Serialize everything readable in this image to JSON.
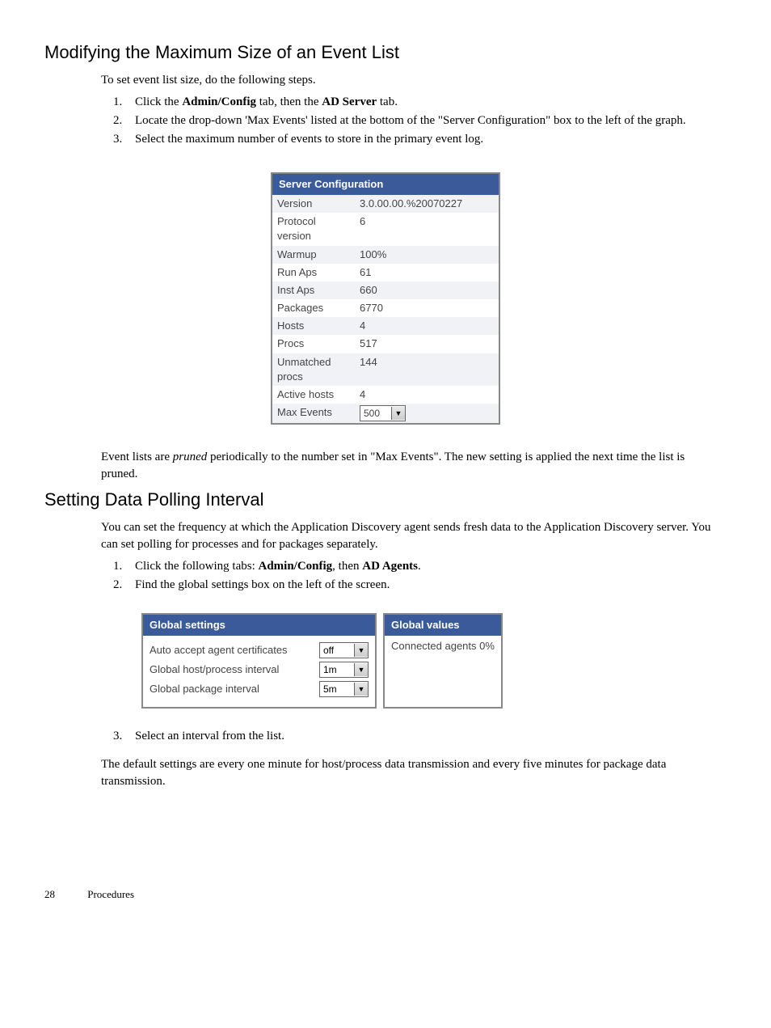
{
  "section1": {
    "heading": "Modifying the Maximum Size of an Event List",
    "intro": "To set event list size, do the following steps.",
    "steps": [
      {
        "pre": "Click the ",
        "b1": "Admin/Config",
        "mid": " tab, then the ",
        "b2": "AD Server",
        "post": " tab."
      },
      {
        "text": "Locate the drop-down 'Max Events' listed at the bottom of the \"Server Configuration\" box to the left of the graph."
      },
      {
        "text": "Select the maximum number of events to store in the primary event log."
      }
    ],
    "para2_a": "Event lists are ",
    "para2_i": "pruned",
    "para2_b": " periodically to the number set in \"Max Events\". The new setting is applied the next time the list is pruned."
  },
  "server_config": {
    "title": "Server Configuration",
    "rows": [
      {
        "label": "Version",
        "value": "3.0.00.00.%20070227"
      },
      {
        "label": "Protocol version",
        "value": "6"
      },
      {
        "label": "Warmup",
        "value": "100%"
      },
      {
        "label": "Run Aps",
        "value": "61"
      },
      {
        "label": "Inst Aps",
        "value": "660"
      },
      {
        "label": "Packages",
        "value": "6770"
      },
      {
        "label": "Hosts",
        "value": "4"
      },
      {
        "label": "Procs",
        "value": "517"
      },
      {
        "label": "Unmatched procs",
        "value": "144"
      },
      {
        "label": "Active hosts",
        "value": "4"
      }
    ],
    "max_events_label": "Max Events",
    "max_events_value": "500"
  },
  "section2": {
    "heading": "Setting Data Polling Interval",
    "intro": "You can set the frequency at which the Application Discovery agent sends fresh data to the Application Discovery server. You can set polling for processes and for packages separately.",
    "steps": [
      {
        "pre": "Click the following tabs: ",
        "b1": "Admin/Config",
        "mid": ", then ",
        "b2": "AD Agents",
        "post": "."
      },
      {
        "text": "Find the global settings box on the left of the screen."
      }
    ],
    "step3": "Select an interval from the list.",
    "after": "The default settings are every one minute for host/process data transmission and every five minutes for package data transmission."
  },
  "global_settings": {
    "title": "Global settings",
    "rows": [
      {
        "label": "Auto accept agent certificates",
        "value": "off"
      },
      {
        "label": "Global host/process interval",
        "value": "1m"
      },
      {
        "label": "Global package interval",
        "value": "5m"
      }
    ]
  },
  "global_values": {
    "title": "Global values",
    "label": "Connected agents",
    "value": "0%"
  },
  "footer": {
    "page": "28",
    "section": "Procedures"
  }
}
